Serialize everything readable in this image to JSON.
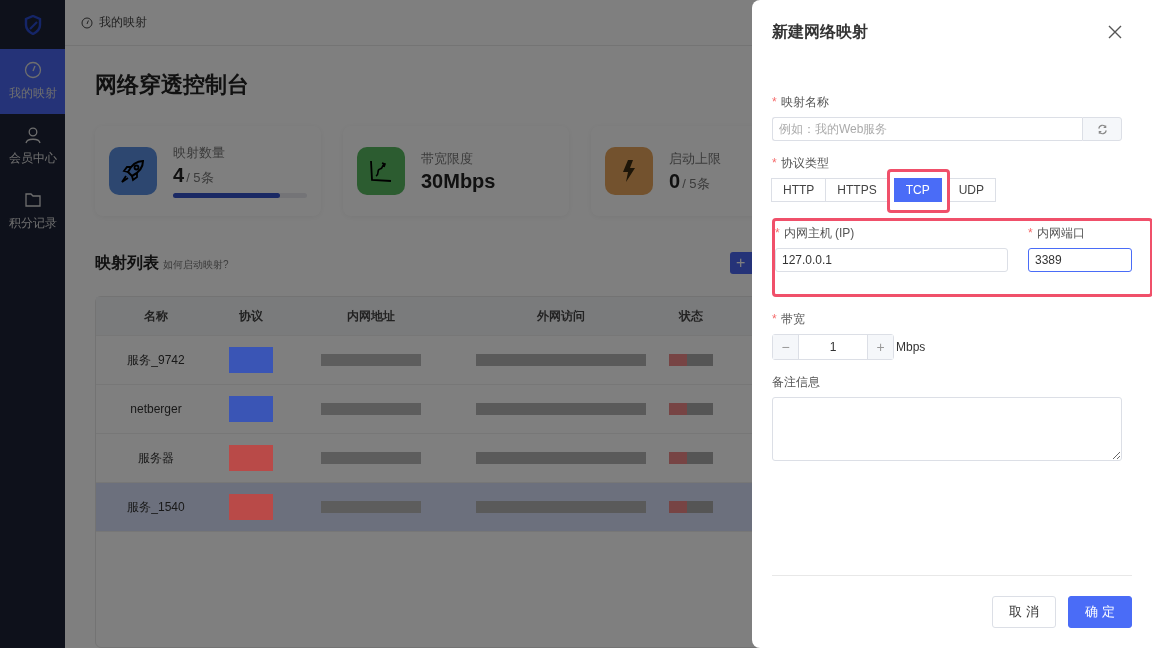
{
  "sidebar": {
    "items": [
      {
        "label": "我的映射",
        "selected": true
      },
      {
        "label": "会员中心",
        "selected": false
      },
      {
        "label": "积分记录",
        "selected": false
      }
    ]
  },
  "breadcrumb": "我的映射",
  "page_title": "网络穿透控制台",
  "stats": [
    {
      "label": "映射数量",
      "value": "4",
      "suffix": " / 5条",
      "level": 0.8
    },
    {
      "label": "带宽限度",
      "value": "30Mbps"
    },
    {
      "label": "启动上限",
      "value": "0",
      "suffix": "/ 5条"
    }
  ],
  "list": {
    "title": "映射列表",
    "help_link": "如何启动映射?",
    "add_button": "+"
  },
  "table": {
    "columns": [
      "名称",
      "协议",
      "内网地址",
      "外网访问",
      "状态"
    ],
    "rows": [
      {
        "name": "服务_9742",
        "color": "#3a55b5",
        "selected": false
      },
      {
        "name": "netberger",
        "color": "#3a55b5",
        "selected": false
      },
      {
        "name": "服务器",
        "color": "#b94a48",
        "selected": false
      },
      {
        "name": "服务_1540",
        "color": "#b94a48",
        "selected": true
      }
    ]
  },
  "dialog": {
    "title": "新建网络映射",
    "name_field": {
      "label": "映射名称",
      "required_mark": "*",
      "placeholder": "例如：我的Web服务"
    },
    "protocol": {
      "label": "协议类型",
      "required_mark": "*",
      "options": [
        {
          "label": "HTTP",
          "selected": false
        },
        {
          "label": "HTTPS",
          "selected": false
        },
        {
          "label": "TCP",
          "selected": true
        },
        {
          "label": "UDP",
          "selected": false
        }
      ]
    },
    "host_field": {
      "label": "内网主机 (IP)",
      "required_mark": "*",
      "value": "127.0.0.1"
    },
    "port_field": {
      "label": "内网端口",
      "required_mark": "*",
      "value": "3389",
      "focused": true
    },
    "bandwidth": {
      "label": "带宽",
      "required_mark": "*",
      "minus": "−",
      "value": "1",
      "plus": "+",
      "unit": "Mbps"
    },
    "remarks": {
      "label": "备注信息"
    },
    "buttons": [
      {
        "label": "取 消",
        "kind": "secondary"
      },
      {
        "label": "确 定",
        "kind": "primary"
      }
    ]
  }
}
